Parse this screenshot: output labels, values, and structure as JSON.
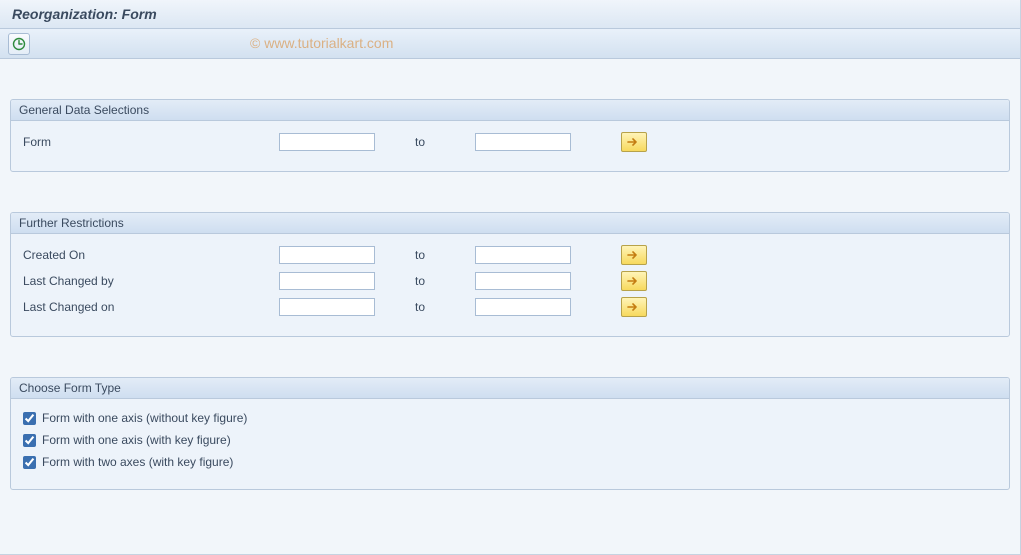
{
  "title": "Reorganization: Form",
  "watermark": "© www.tutorialkart.com",
  "groups": {
    "general": {
      "header": "General Data Selections",
      "rows": [
        {
          "label": "Form",
          "from": "",
          "to_label": "to",
          "to": ""
        }
      ]
    },
    "further": {
      "header": "Further Restrictions",
      "rows": [
        {
          "label": "Created On",
          "from": "",
          "to_label": "to",
          "to": ""
        },
        {
          "label": "Last Changed by",
          "from": "",
          "to_label": "to",
          "to": ""
        },
        {
          "label": "Last Changed on",
          "from": "",
          "to_label": "to",
          "to": ""
        }
      ]
    },
    "formtype": {
      "header": "Choose Form Type",
      "checks": [
        {
          "label": "Form with one axis (without key figure)",
          "checked": true
        },
        {
          "label": "Form with one axis (with key figure)",
          "checked": true
        },
        {
          "label": "Form with two axes (with key figure)",
          "checked": true
        }
      ]
    }
  }
}
